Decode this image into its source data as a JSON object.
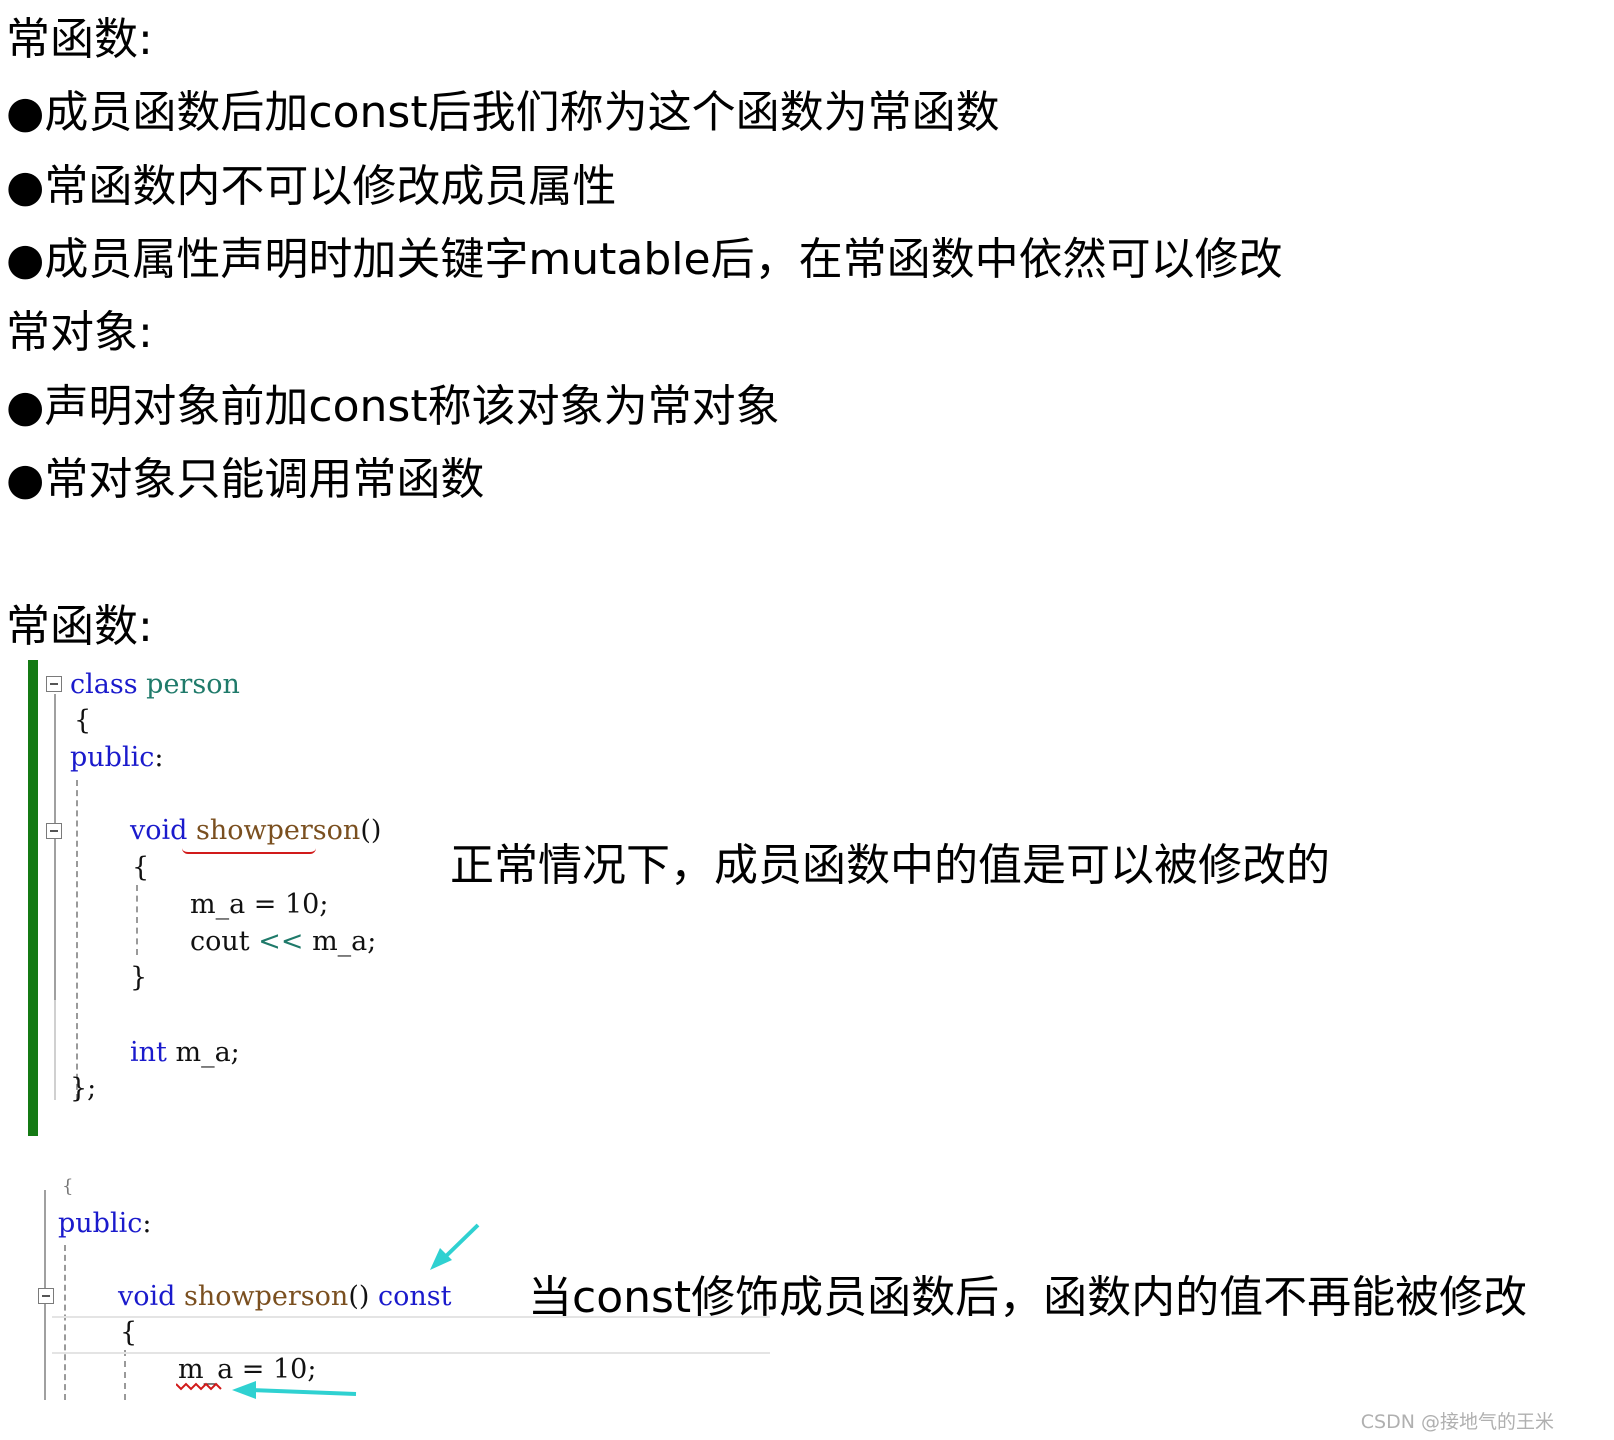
{
  "notes": {
    "heading1": "常函数:",
    "bullets1": [
      "●成员函数后加const后我们称为这个函数为常函数",
      "●常函数内不可以修改成员属性",
      "●成员属性声明时加关键字mutable后，在常函数中依然可以修改"
    ],
    "heading2": "常对象:",
    "bullets2": [
      "●声明对象前加const称该对象为常对象",
      "●常对象只能调用常函数"
    ]
  },
  "section": {
    "heading": "常函数:"
  },
  "code1": {
    "kw_class": "class",
    "class_name": "person",
    "open_brace": "{",
    "kw_public": "public",
    "colon": ":",
    "kw_void": "void",
    "fn_name": "showperson",
    "parens": "()",
    "inner_open": "{",
    "assign_line": "m_a = 10;",
    "cout_word": "cout",
    "cout_op": "<<",
    "cout_rest": "m_a;",
    "inner_close": "}",
    "kw_int": "int",
    "member_decl": "m_a;",
    "close": "};"
  },
  "annotation1": "正常情况下，成员函数中的值是可以被修改的",
  "code2": {
    "top_fragment": "{",
    "kw_public": "public",
    "colon": ":",
    "kw_void": "void",
    "fn_name": "showperson",
    "parens": "()",
    "kw_const": "const",
    "inner_open": "{",
    "assign_line": "m_a = 10;"
  },
  "annotation2": "当const修饰成员函数后，函数内的值不再能被修改",
  "watermark": "CSDN @接地气的王米",
  "colors": {
    "keyword": "#1a1acc",
    "class_name": "#1f7a6a",
    "function_name": "#7a4f1f",
    "change_bar": "#147a14",
    "arrow": "#2fd1d1",
    "squiggle": "#d11a1a"
  }
}
